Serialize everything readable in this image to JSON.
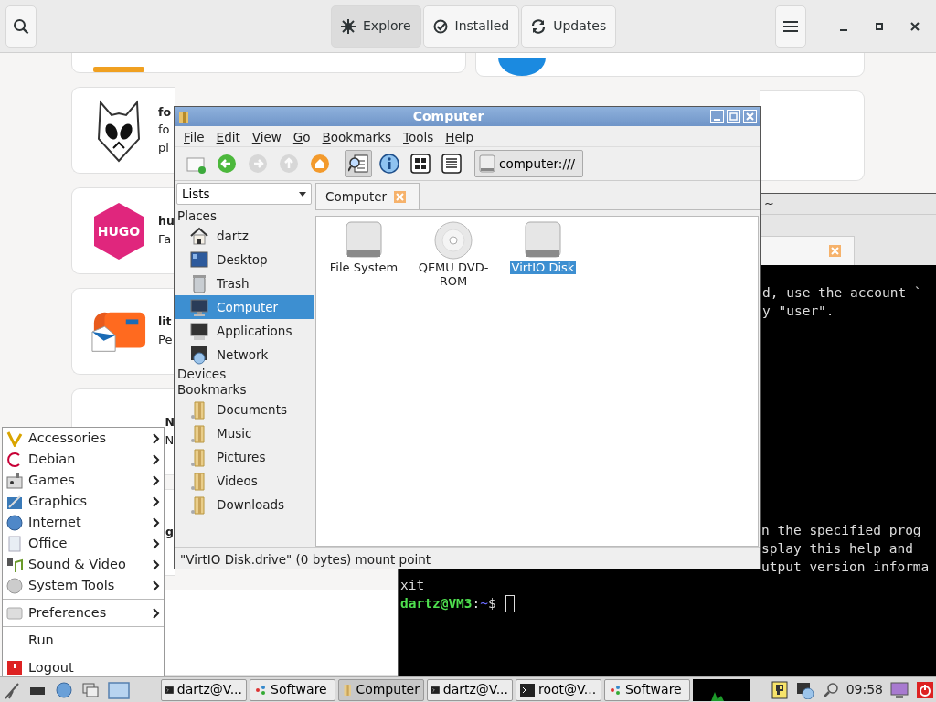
{
  "software": {
    "tabs": [
      {
        "label": "Explore",
        "selected": true
      },
      {
        "label": "Installed",
        "selected": false
      },
      {
        "label": "Updates",
        "selected": false
      }
    ],
    "cards": [
      {
        "title": "fo",
        "description": [
          "fo",
          "pl"
        ]
      },
      {
        "icon_text": "HUGO",
        "title": "hu",
        "description": [
          "Fa"
        ]
      },
      {
        "title": "lit",
        "description": [
          "Pe"
        ]
      },
      {
        "title": "N",
        "description": [
          "N"
        ]
      },
      {
        "title": "g"
      }
    ]
  },
  "terminal": {
    "title": "~",
    "upper_lines": [
      "d, use the account `",
      "y \"user\"."
    ],
    "lower_lines": [
      "n the specified prog",
      "splay this help and",
      "utput version informa"
    ],
    "lines": [
      "xit"
    ],
    "prompt": {
      "user": "dartz@VM3",
      "separator": ":",
      "path": "~",
      "symbol": "$"
    }
  },
  "file_manager": {
    "title": "Computer",
    "menu": [
      "File",
      "Edit",
      "View",
      "Go",
      "Bookmarks",
      "Tools",
      "Help"
    ],
    "toolbar": [
      {
        "kind": "new-tab",
        "enabled": true,
        "pressed": false
      },
      {
        "kind": "back",
        "enabled": true,
        "pressed": false
      },
      {
        "kind": "forward",
        "enabled": false,
        "pressed": false
      },
      {
        "kind": "up",
        "enabled": false,
        "pressed": false
      },
      {
        "kind": "home",
        "enabled": true,
        "pressed": false
      },
      {
        "kind": "search",
        "enabled": true,
        "pressed": true
      },
      {
        "kind": "info",
        "enabled": true,
        "pressed": false
      },
      {
        "kind": "icons",
        "enabled": true,
        "pressed": false
      },
      {
        "kind": "list",
        "enabled": true,
        "pressed": false
      }
    ],
    "location": "computer:///",
    "side_pane": "Lists",
    "tab": "Computer",
    "sections": [
      {
        "label": "Places",
        "items": [
          {
            "label": "dartz",
            "kind": "home",
            "selected": false
          },
          {
            "label": "Desktop",
            "kind": "desktop",
            "selected": false
          },
          {
            "label": "Trash",
            "kind": "trash",
            "selected": false
          },
          {
            "label": "Computer",
            "kind": "computer",
            "selected": true
          },
          {
            "label": "Applications",
            "kind": "applications",
            "selected": false
          },
          {
            "label": "Network",
            "kind": "network",
            "selected": false
          }
        ]
      },
      {
        "label": "Devices"
      },
      {
        "label": "Bookmarks",
        "items": [
          {
            "label": "Documents",
            "kind": "folder",
            "selected": false
          },
          {
            "label": "Music",
            "kind": "folder",
            "selected": false
          },
          {
            "label": "Pictures",
            "kind": "folder",
            "selected": false
          },
          {
            "label": "Videos",
            "kind": "folder",
            "selected": false
          },
          {
            "label": "Downloads",
            "kind": "folder",
            "selected": false
          }
        ]
      }
    ],
    "items": [
      {
        "label": "File System",
        "kind": "drive",
        "selected": false
      },
      {
        "label": "QEMU DVD-ROM",
        "kind": "disc",
        "selected": false
      },
      {
        "label": "VirtIO Disk",
        "kind": "drive",
        "selected": true
      }
    ],
    "status": "\"VirtIO Disk.drive\" (0 bytes) mount point"
  },
  "start_menu": {
    "groups": [
      [
        {
          "label": "Accessories",
          "submenu": true
        },
        {
          "label": "Debian",
          "submenu": true
        },
        {
          "label": "Games",
          "submenu": true
        },
        {
          "label": "Graphics",
          "submenu": true
        },
        {
          "label": "Internet",
          "submenu": true
        },
        {
          "label": "Office",
          "submenu": true
        },
        {
          "label": "Sound & Video",
          "submenu": true
        },
        {
          "label": "System Tools",
          "submenu": true
        }
      ],
      [
        {
          "label": "Preferences",
          "submenu": true
        }
      ],
      [
        {
          "label": "Run",
          "submenu": false
        }
      ],
      [
        {
          "label": "Logout",
          "submenu": false
        }
      ]
    ]
  },
  "taskbar": {
    "tasks": [
      {
        "label": "dartz@V...",
        "kind": "terminal",
        "selected": false
      },
      {
        "label": "Software",
        "kind": "software",
        "selected": false
      },
      {
        "label": "Computer",
        "kind": "folder",
        "selected": true
      },
      {
        "label": "dartz@V...",
        "kind": "terminal",
        "selected": false
      },
      {
        "label": "root@V...",
        "kind": "terminal",
        "selected": false
      },
      {
        "label": "Software",
        "kind": "software",
        "selected": false
      }
    ],
    "clock": "09:58"
  }
}
